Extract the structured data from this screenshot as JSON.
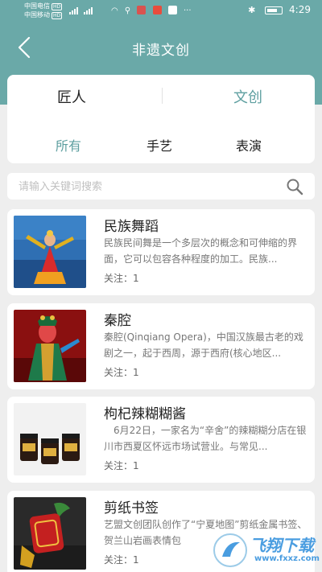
{
  "status_bar": {
    "carrier1": "中国电信",
    "carrier2": "中国移动",
    "hd": "HD",
    "time": "4:29",
    "bluetooth_icon": "bluetooth-icon"
  },
  "header": {
    "title": "非遗文创",
    "back_icon": "chevron-left-icon"
  },
  "tabs": {
    "main": [
      "匠人",
      "文创"
    ],
    "active_main": "文创",
    "sub": [
      "所有",
      "手艺",
      "表演"
    ],
    "active_sub": "所有"
  },
  "search": {
    "placeholder": "请输入关键词搜索",
    "value": "",
    "icon": "search-icon"
  },
  "items": [
    {
      "title": "民族舞蹈",
      "desc": "民族民间舞是一个多层次的概念和可伸缩的界面，它可以包容各种程度的加工。民族...",
      "follow": "关注：1"
    },
    {
      "title": "秦腔",
      "desc": "秦腔(Qinqiang Opera)，中国汉族最古老的戏剧之一，起于西周，源于西府(核心地区...",
      "follow": "关注：1"
    },
    {
      "title": "枸杞辣糊糊酱",
      "desc": "　6月22日，一家名为“辛舍”的辣糊糊分店在银川市西夏区怀远市场试营业。与常见...",
      "follow": "关注：1"
    },
    {
      "title": "剪纸书签",
      "desc": "艺盟文创团队创作了“宁夏地图”剪纸金属书签、贺兰山岩画表情包",
      "follow": "关注：1"
    }
  ],
  "watermark": {
    "text": "飞翔下载",
    "url": "www.fxxz.com"
  },
  "colors": {
    "accent": "#5e9fa0",
    "header_bg": "#6aa9a8",
    "page_bg": "#eeeeee"
  }
}
